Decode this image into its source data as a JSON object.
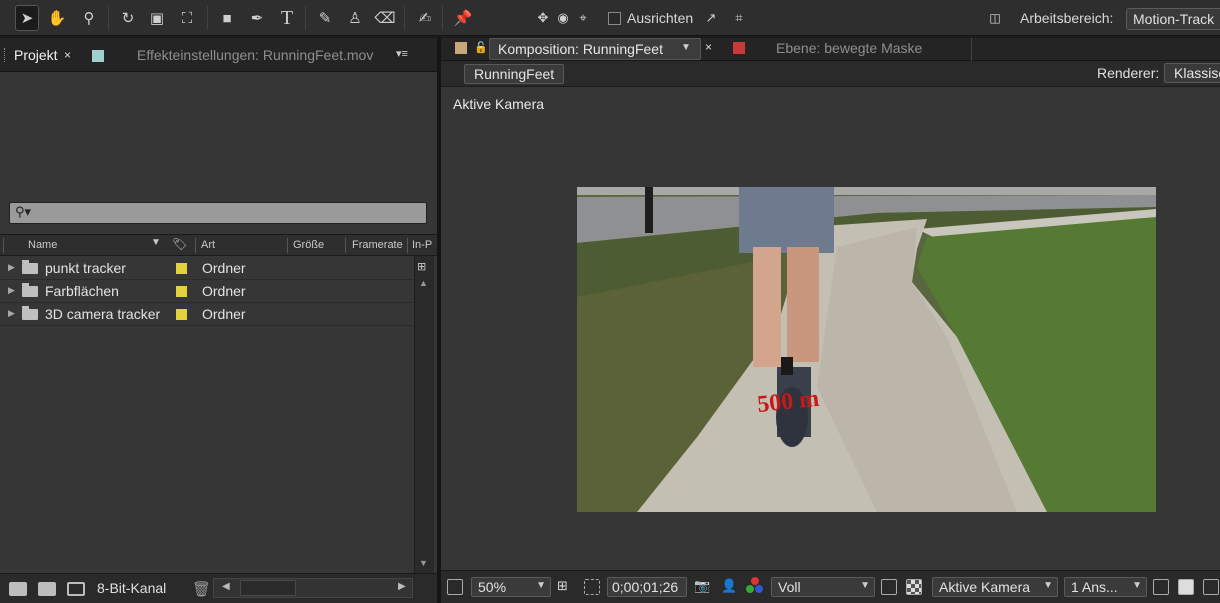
{
  "toolbar": {
    "align_label": "Ausrichten",
    "workspace_label": "Arbeitsbereich:",
    "workspace_value": "Motion-Track"
  },
  "project_panel": {
    "tab_label": "Projekt",
    "tab_close": "×",
    "effects_tab_label": "Effekteinstellungen: RunningFeet.mov",
    "search_glyph": "⚲▾",
    "columns": [
      "Name",
      "Art",
      "Größe",
      "Framerate",
      "In-P"
    ],
    "rows": [
      {
        "name": "punkt tracker",
        "type": "Ordner"
      },
      {
        "name": "Farbflächen",
        "type": "Ordner"
      },
      {
        "name": "3D camera tracker",
        "type": "Ordner"
      }
    ],
    "bit_depth": "8-Bit-Kanal"
  },
  "composition_panel": {
    "tab_label": "Komposition: RunningFeet",
    "tab_close": "×",
    "layer_tab_label": "Ebene: bewegte Maske",
    "comp_button": "RunningFeet",
    "renderer_label": "Renderer:",
    "renderer_value": "Klassisc",
    "view_label": "Aktive Kamera",
    "footage_overlay_text": "500 m",
    "zoom": "50%",
    "timecode": "0;00;01;26",
    "resolution": "Voll",
    "camera": "Aktive Kamera",
    "views": "1 Ans..."
  },
  "colors": {
    "label_yellow": "#e2d33d",
    "layer_red": "#c83a3a",
    "effects_teal": "#9fd0cc",
    "comp_tan": "#c8a878"
  }
}
